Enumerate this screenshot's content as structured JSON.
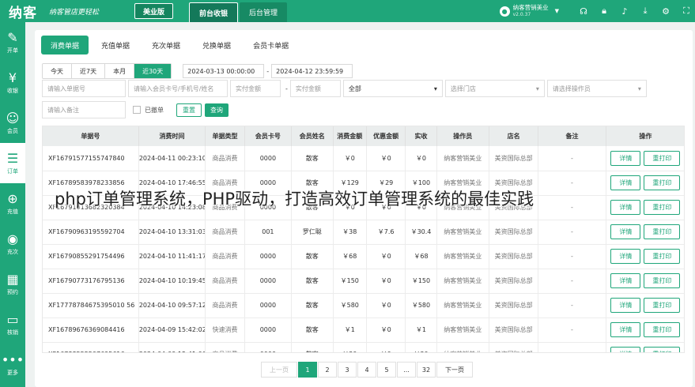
{
  "header": {
    "logo": "纳客",
    "slogan": "纳客管店更轻松",
    "edition_label": "美业版",
    "nav": [
      {
        "label": "前台收银",
        "active": true
      },
      {
        "label": "后台管理",
        "active": false
      }
    ],
    "user": {
      "name": "纳客营销美业",
      "version": "v2.0.37"
    },
    "icons": [
      "headset-icon",
      "lock-icon",
      "bell-icon",
      "download-icon",
      "settings-icon",
      "fullscreen-icon"
    ]
  },
  "sidebar": {
    "items": [
      {
        "label": "开单",
        "icon": "edit-icon",
        "active": false
      },
      {
        "label": "收银",
        "icon": "cashier-icon",
        "active": false
      },
      {
        "label": "会员",
        "icon": "member-icon",
        "active": false
      },
      {
        "label": "订单",
        "icon": "order-icon",
        "active": true
      },
      {
        "label": "充值",
        "icon": "recharge-icon",
        "active": false
      },
      {
        "label": "充次",
        "icon": "times-icon",
        "active": false
      },
      {
        "label": "预约",
        "icon": "calendar-icon",
        "active": false
      },
      {
        "label": "核销",
        "icon": "ticket-icon",
        "active": false
      },
      {
        "label": "更多",
        "icon": "more-icon",
        "active": false
      }
    ]
  },
  "tabs": [
    {
      "label": "消费单据",
      "active": true
    },
    {
      "label": "充值单据",
      "active": false
    },
    {
      "label": "充次单据",
      "active": false
    },
    {
      "label": "兑换单据",
      "active": false
    },
    {
      "label": "会员卡单据",
      "active": false
    }
  ],
  "filters": {
    "ranges": [
      {
        "label": "今天",
        "active": false
      },
      {
        "label": "近7天",
        "active": false
      },
      {
        "label": "本月",
        "active": false
      },
      {
        "label": "近30天",
        "active": true
      }
    ],
    "date_start": "2024-03-13 00:00:00",
    "date_end": "2024-04-12 23:59:59",
    "order_no_placeholder": "请输入单据号",
    "member_placeholder": "请输入会员卡号/手机号/姓名",
    "amount_min_placeholder": "实付金额",
    "amount_max_placeholder": "实付金额",
    "type_value": "全部",
    "store_placeholder": "选择门店",
    "operator_placeholder": "请选择操作员",
    "remark_placeholder": "请输入备注",
    "cancelled_label": "已撤单",
    "reset_label": "重置",
    "query_label": "查询"
  },
  "table": {
    "columns": [
      "单据号",
      "消费时间",
      "单据类型",
      "会员卡号",
      "会员姓名",
      "消费金额",
      "优惠金额",
      "实收",
      "操作员",
      "店名",
      "备注",
      "操作"
    ],
    "detail_label": "详情",
    "reprint_label": "重打印",
    "rows": [
      [
        "XF16791577155747840",
        "2024-04-11 00:23:10",
        "商品消费",
        "0000",
        "散客",
        "￥0",
        "￥0",
        "￥0",
        "纳客营销美业",
        "美资国际总部",
        "-"
      ],
      [
        "XF16789583978233856",
        "2024-04-10 17:46:55",
        "商品消费",
        "0000",
        "散客",
        "￥129",
        "￥29",
        "￥100",
        "纳客营销美业",
        "美资国际总部",
        "-"
      ],
      [
        "XF16791013682320384",
        "2024-04-10 14:23:08",
        "商品消费",
        "0000",
        "散客",
        "￥0",
        "￥0",
        "￥0",
        "纳客营销美业",
        "美资国际总部",
        "-"
      ],
      [
        "XF16790963195592704",
        "2024-04-10 13:31:03",
        "商品消费",
        "001",
        "罗仁聪",
        "￥38",
        "￥7.6",
        "￥30.4",
        "纳客营销美业",
        "美资国际总部",
        "-"
      ],
      [
        "XF16790855291754496",
        "2024-04-10 11:41:17",
        "商品消费",
        "0000",
        "散客",
        "￥68",
        "￥0",
        "￥68",
        "纳客营销美业",
        "美资国际总部",
        "-"
      ],
      [
        "XF16790773176795136",
        "2024-04-10 10:19:45",
        "商品消费",
        "0000",
        "散客",
        "￥150",
        "￥0",
        "￥150",
        "纳客营销美业",
        "美资国际总部",
        "-"
      ],
      [
        "XF17778784675395010 56",
        "2024-04-10 09:57:12",
        "商品消费",
        "0000",
        "散客",
        "￥580",
        "￥0",
        "￥580",
        "纳客营销美业",
        "美资国际总部",
        "-"
      ],
      [
        "XF16789676369084416",
        "2024-04-09 15:42:02",
        "快速消费",
        "0000",
        "散客",
        "￥1",
        "￥0",
        "￥1",
        "纳客营销美业",
        "美资国际总部",
        "-"
      ],
      [
        "XF16788555507695616",
        "2024-04-09 15:41:00",
        "商品消费",
        "0000",
        "散客",
        "￥30",
        "￥0",
        "￥30",
        "纳客营销美业",
        "美资国际总部",
        "-"
      ]
    ]
  },
  "pagination": {
    "prev": "上一页",
    "pages": [
      "1",
      "2",
      "3",
      "4",
      "5",
      "...",
      "32"
    ],
    "current": "1",
    "next": "下一页"
  },
  "overlay_text": "php订单管理系统，PHP驱动，打造高效订单管理系统的最佳实践"
}
